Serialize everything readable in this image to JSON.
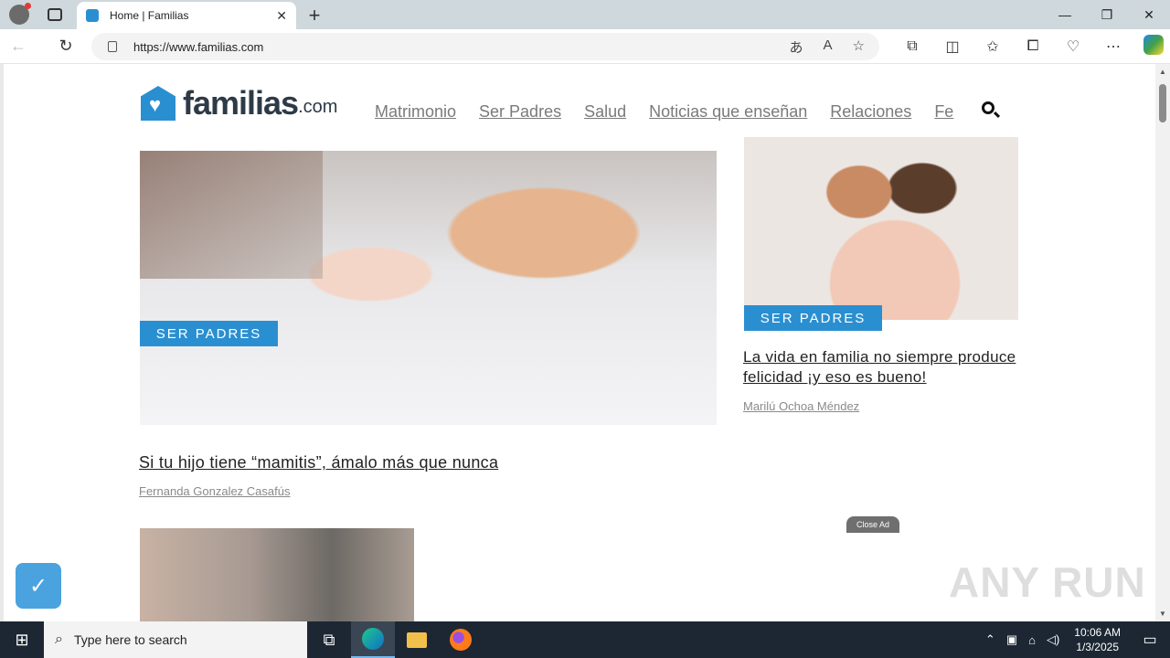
{
  "browser": {
    "tab_title": "Home | Familias",
    "url": "https://www.familias.com",
    "new_tab": "+",
    "tab_close": "✕",
    "win": {
      "min": "—",
      "restore": "❐",
      "close": "✕"
    }
  },
  "site": {
    "logo_word": "familias",
    "logo_suffix": ".com",
    "menu": [
      "Matrimonio",
      "Ser Padres",
      "Salud",
      "Noticias que enseñan",
      "Relaciones",
      "Fe"
    ]
  },
  "hero": {
    "category": "SER PADRES",
    "title": "Si tu hijo tiene “mamitis”, ámalo más que nunca",
    "author": "Fernanda Gonzalez Casafús"
  },
  "side": {
    "category": "SER PADRES",
    "title": "La vida en familia no siempre produce felicidad ¡y eso es bueno!",
    "author": "Marilú Ochoa Méndez"
  },
  "ad": {
    "close_label": "Close Ad"
  },
  "watermark": "ANY RUN",
  "taskbar": {
    "search_placeholder": "Type here to search",
    "time": "10:06 AM",
    "date": "1/3/2025"
  }
}
